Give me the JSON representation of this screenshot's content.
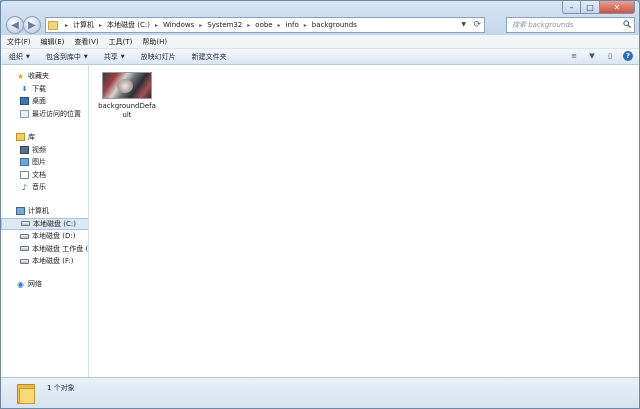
{
  "window_controls": {
    "minimize": "–",
    "maximize": "□",
    "close": "✕"
  },
  "nav": {
    "back_icon": "◀",
    "forward_icon": "▶",
    "dropdown_icon": "▼"
  },
  "address": {
    "crumbs": [
      "计算机",
      "本地磁盘 (C:)",
      "Windows",
      "System32",
      "oobe",
      "info",
      "backgrounds"
    ],
    "separator": "▸",
    "dropdown_icon": "▼",
    "refresh_icon": "⟳"
  },
  "search": {
    "placeholder": "搜索 backgrounds",
    "icon": "search-icon"
  },
  "menu": [
    "文件(F)",
    "编辑(E)",
    "查看(V)",
    "工具(T)",
    "帮助(H)"
  ],
  "commands": [
    {
      "label": "组织",
      "dropdown": true
    },
    {
      "label": "包含到库中",
      "dropdown": true
    },
    {
      "label": "共享",
      "dropdown": true
    },
    {
      "label": "放映幻灯片",
      "dropdown": false
    },
    {
      "label": "新建文件夹",
      "dropdown": false
    }
  ],
  "command_right": {
    "view_icon": "≡",
    "view_caret": "▼",
    "pane_icon": "▯",
    "help_label": "?"
  },
  "sidebar": {
    "favorites": {
      "title": "收藏夹",
      "items": [
        "下载",
        "桌面",
        "最近访问的位置"
      ]
    },
    "libraries": {
      "title": "库",
      "items": [
        "视频",
        "图片",
        "文档",
        "音乐"
      ]
    },
    "computer": {
      "title": "计算机",
      "items": [
        "本地磁盘 (C:)",
        "本地磁盘 (D:)",
        "本地磁盘 工作盘 (E:)",
        "本地磁盘 (F:)"
      ],
      "selected_index": 0
    },
    "network": {
      "title": "网络"
    }
  },
  "files": [
    {
      "name": "backgroundDefault"
    }
  ],
  "status": {
    "count_text": "1 个对象"
  }
}
